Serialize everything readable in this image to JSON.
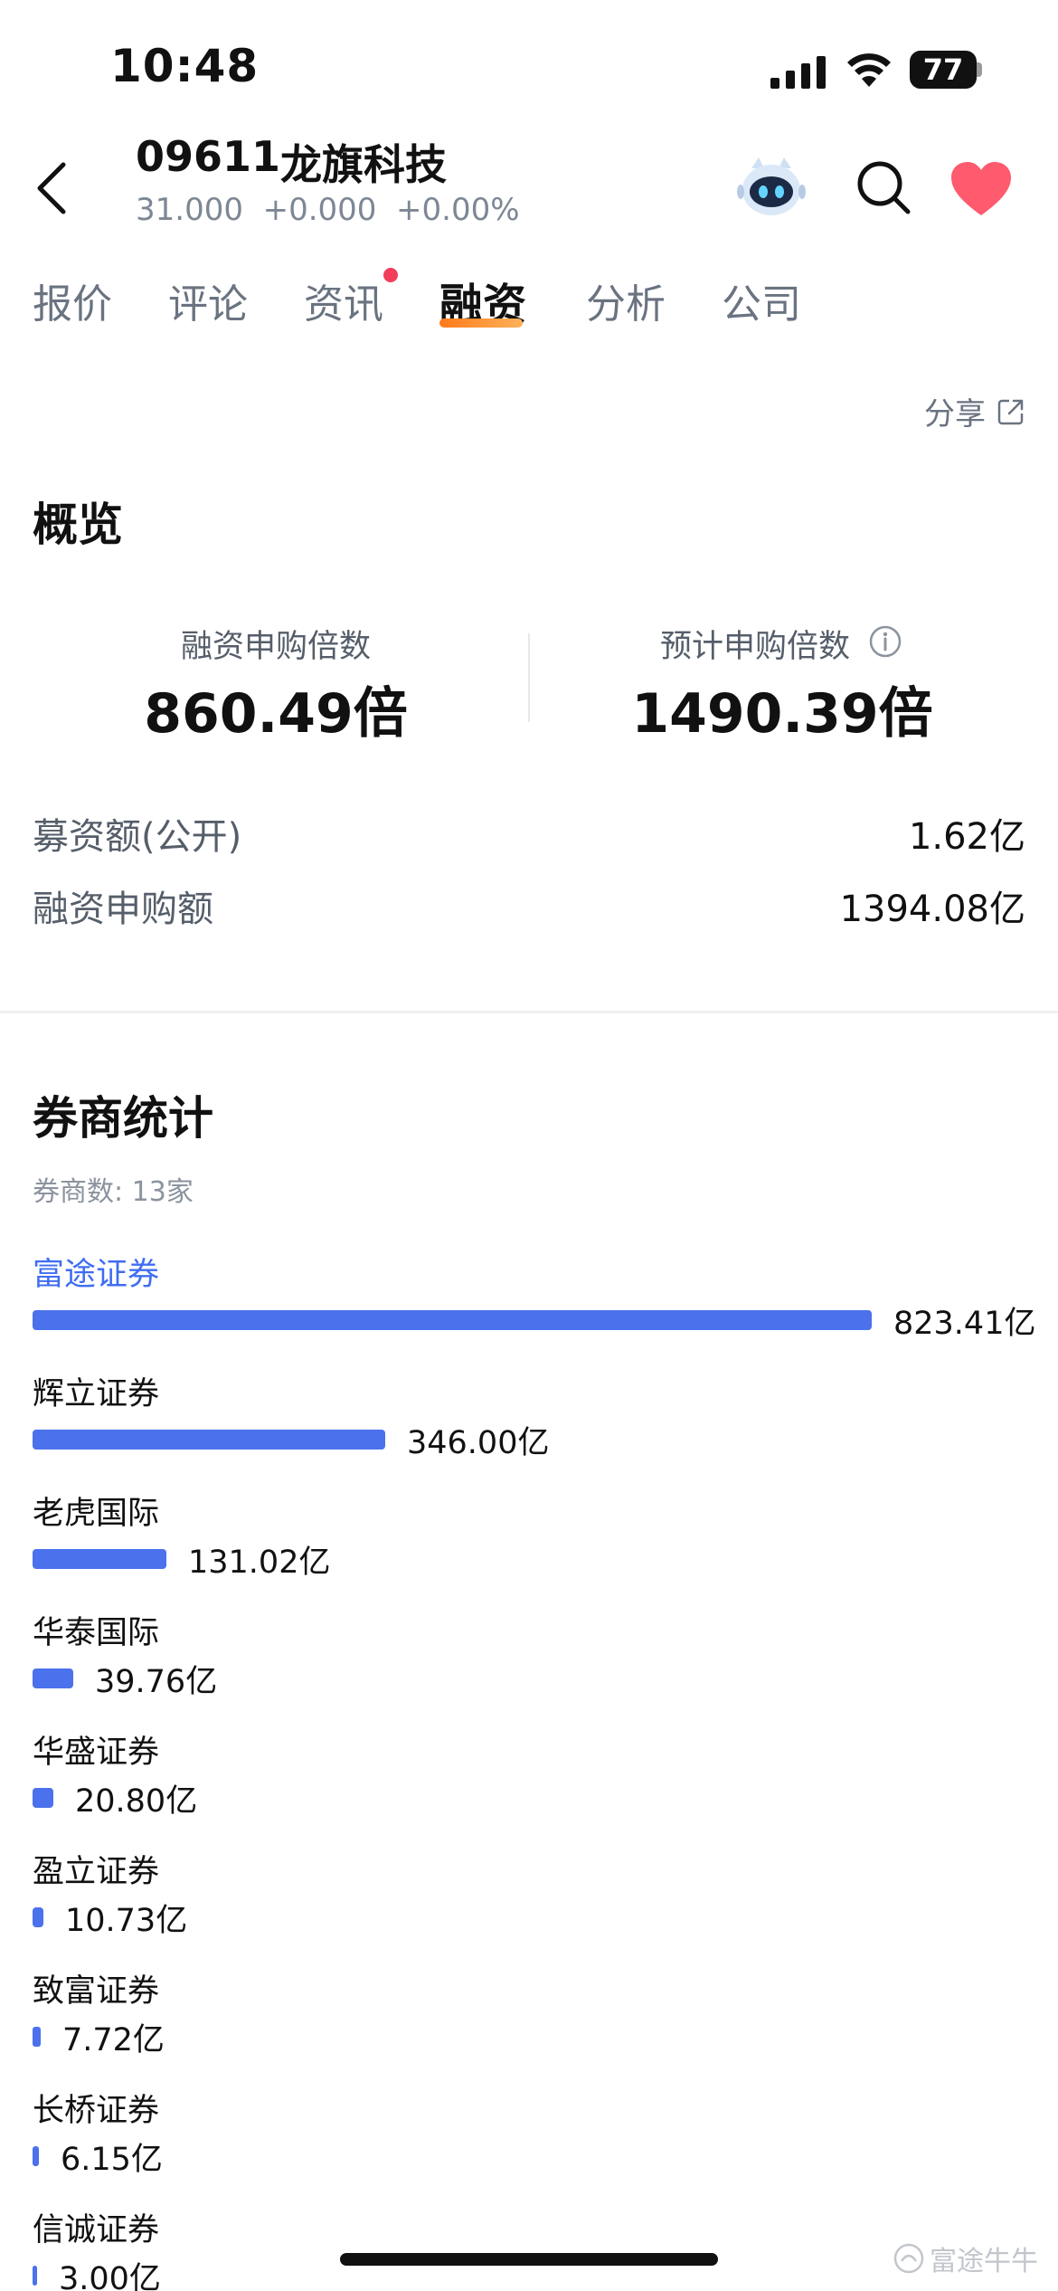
{
  "status_bar": {
    "time": "10:48",
    "battery": "77"
  },
  "header": {
    "code": "09611",
    "name": "龙旗科技",
    "quote": "31.000  +0.000  +0.00%"
  },
  "tabs": [
    {
      "label": "报价",
      "active": false
    },
    {
      "label": "评论",
      "active": false
    },
    {
      "label": "资讯",
      "active": false,
      "dot": true
    },
    {
      "label": "融资",
      "active": true
    },
    {
      "label": "分析",
      "active": false
    },
    {
      "label": "公司",
      "active": false
    }
  ],
  "share_label": "分享",
  "overview": {
    "title": "概览",
    "margin_multiple_label": "融资申购倍数",
    "margin_multiple_value": "860.49倍",
    "estimated_multiple_label": "预计申购倍数",
    "estimated_multiple_value": "1490.39倍",
    "rows": [
      {
        "label": "募资额(公开)",
        "value": "1.62亿"
      },
      {
        "label": "融资申购额",
        "value": "1394.08亿"
      }
    ]
  },
  "brokers": {
    "title": "券商统计",
    "count_text": "券商数: 13家",
    "items": [
      {
        "name": "富途证券",
        "amount": 823.41,
        "value_text": "823.41亿",
        "highlight": true
      },
      {
        "name": "辉立证券",
        "amount": 346.0,
        "value_text": "346.00亿"
      },
      {
        "name": "老虎国际",
        "amount": 131.02,
        "value_text": "131.02亿"
      },
      {
        "name": "华泰国际",
        "amount": 39.76,
        "value_text": "39.76亿"
      },
      {
        "name": "华盛证券",
        "amount": 20.8,
        "value_text": "20.80亿"
      },
      {
        "name": "盈立证券",
        "amount": 10.73,
        "value_text": "10.73亿"
      },
      {
        "name": "致富证券",
        "amount": 7.72,
        "value_text": "7.72亿"
      },
      {
        "name": "长桥证券",
        "amount": 6.15,
        "value_text": "6.15亿"
      },
      {
        "name": "信诚证券",
        "amount": 3.0,
        "value_text": "3.00亿"
      }
    ]
  },
  "watermark": "富途牛牛",
  "colors": {
    "bar": "#4b71ec",
    "highlight": "#3f6df2",
    "favorite": "#ff5a6e",
    "tab_accent": "#ff7a1a"
  }
}
